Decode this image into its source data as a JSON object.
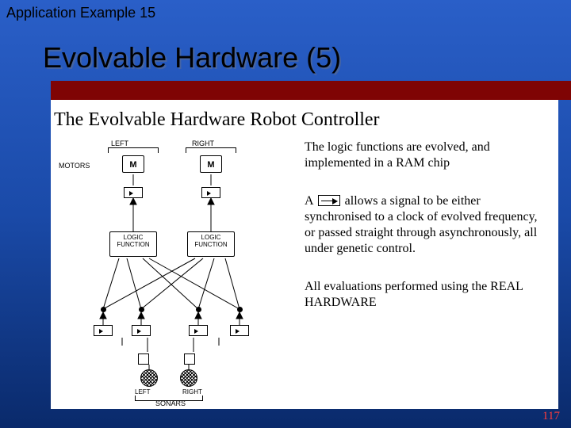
{
  "header_label": "Application Example 15",
  "title": "Evolvable Hardware (5)",
  "subtitle": "The Evolvable Hardware Robot Controller",
  "paragraphs": {
    "p1": "The logic functions are evolved, and implemented in a RAM chip",
    "p2_prefix": "A ",
    "p2_suffix": " allows a signal to be either synchronised to a clock of evolved frequency, or passed straight through asynchronously, all under genetic control.",
    "p3": "All evaluations performed using the REAL HARDWARE"
  },
  "diagram": {
    "motors_label": "MOTORS",
    "left": "LEFT",
    "right": "RIGHT",
    "m": "M",
    "logic_line1": "LOGIC",
    "logic_line2": "FUNCTION",
    "sonars_left": "LEFT",
    "sonars_right": "RIGHT",
    "sonars": "SONARS"
  },
  "page_number": "117"
}
